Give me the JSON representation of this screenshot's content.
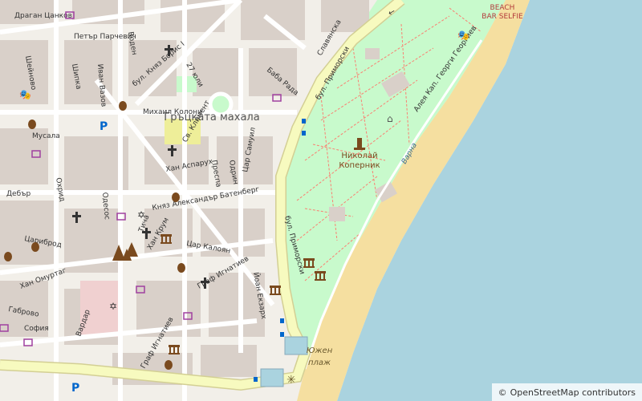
{
  "colors": {
    "land": "#f2efe9",
    "sea": "#aad3df",
    "park": "#c8facc",
    "beach": "#f5dfa0",
    "road_major": "#f7fabf",
    "road_major_edge": "#d3cf94",
    "road_minor": "#ffffff",
    "block": "#d9d0c9",
    "path": "#fa8072",
    "poi_brown": "#7a4a1e"
  },
  "labels": {
    "district": "Гръцката махала",
    "monument_name_1": "Николай",
    "monument_name_2": "Коперник",
    "beach_1": "Южен",
    "beach_2": "плаж",
    "bar_1": "BEACH",
    "bar_2": "BAR SELFIE",
    "sea_label": "Варна",
    "parking": "P"
  },
  "streets": [
    "Драган Цанков",
    "Петър Парчевич",
    "Шипка",
    "Шейново",
    "Иван Вазов",
    "Воден",
    "бул. Княз Борис I",
    "27 юли",
    "Михаил Колони",
    "Баба Рада",
    "Славянска",
    "бул. Приморски",
    "Алея Кап. Георги Георгиев",
    "Мусала",
    "Св. Климент",
    "Преспа",
    "Одрин",
    "Цар Самуил",
    "Хан Аспарух",
    "Охрид",
    "Дебър",
    "Одесос",
    "Княз Александър Батенберг",
    "Тича",
    "Хан Крум",
    "Цар Калоян",
    "Цариброд",
    "Хан Омуртаг",
    "Граф Игнатиев",
    "Йоан Екзарх",
    "Габрово",
    "София",
    "Вардар",
    "Славянска"
  ],
  "attribution": {
    "symbol": "©",
    "text": "OpenStreetMap contributors"
  }
}
